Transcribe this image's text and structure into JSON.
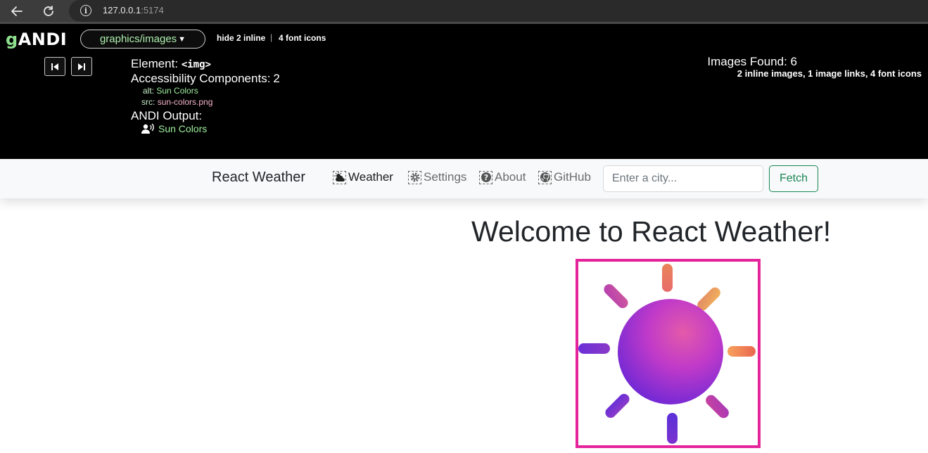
{
  "browser": {
    "url_host": "127.0.0.1",
    "url_port": ":5174",
    "back_icon": "arrow-left-icon",
    "reload_icon": "reload-icon",
    "info_icon": "info-icon"
  },
  "andi": {
    "logo_g": "g",
    "logo_rest": "ANDI",
    "module": "graphics/images",
    "hide_inline": "hide 2 inline",
    "separator": "|",
    "font_icons": "4 font icons",
    "element_label": "Element:",
    "element_tag": "<img>",
    "accessibility_label": "Accessibility Components:",
    "accessibility_count": "2",
    "alt_name": "alt:",
    "alt_value": "Sun Colors",
    "src_name": "src:",
    "src_value": "sun-colors.png",
    "output_label": "ANDI Output:",
    "output_value": "Sun Colors",
    "images_found": "Images Found: 6",
    "images_summary": "2 inline images, 1 image links, 4 font icons",
    "colors": {
      "logo_g": "#8ee08e",
      "alt": "#9ff09f",
      "src": "#f5b3c8"
    }
  },
  "navbar": {
    "brand": "React Weather",
    "links": [
      {
        "label": "Weather",
        "icon": "cloud-sun-icon"
      },
      {
        "label": "Settings",
        "icon": "gear-icon"
      },
      {
        "label": "About",
        "icon": "question-circle-icon"
      },
      {
        "label": "GitHub",
        "icon": "github-icon"
      }
    ],
    "search_placeholder": "Enter a city...",
    "fetch_label": "Fetch",
    "colors": {
      "fetch": "#198754"
    }
  },
  "main": {
    "title": "Welcome to React Weather!",
    "image_alt": "Sun Colors",
    "highlight_color": "#e5249c"
  }
}
